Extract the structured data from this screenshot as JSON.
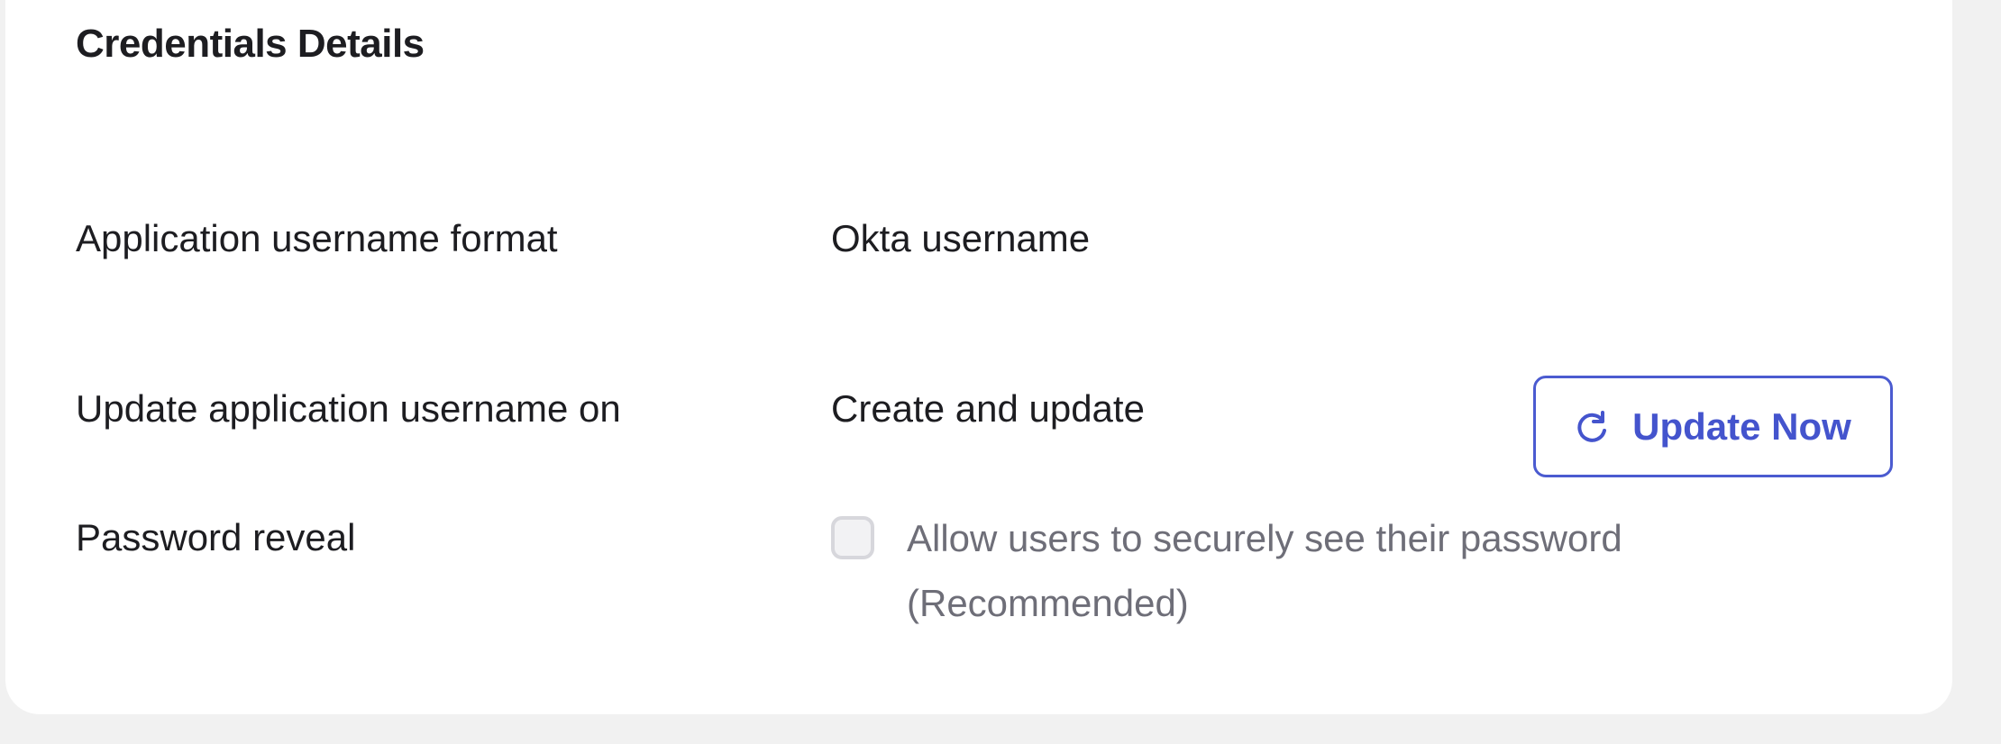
{
  "section": {
    "title": "Credentials Details"
  },
  "rows": {
    "username_format": {
      "label": "Application username format",
      "value": "Okta username"
    },
    "update_on": {
      "label": "Update application username on",
      "value": "Create and update"
    },
    "password_reveal": {
      "label": "Password reveal",
      "checkbox_label": "Allow users to securely see their password (Recommended)",
      "checked": false
    }
  },
  "buttons": {
    "update_now": {
      "label": "Update Now",
      "icon": "refresh-icon"
    }
  },
  "colors": {
    "accent": "#4454cd",
    "background": "#f1f1f1",
    "card": "#ffffff",
    "muted_text": "#6e6e78"
  }
}
